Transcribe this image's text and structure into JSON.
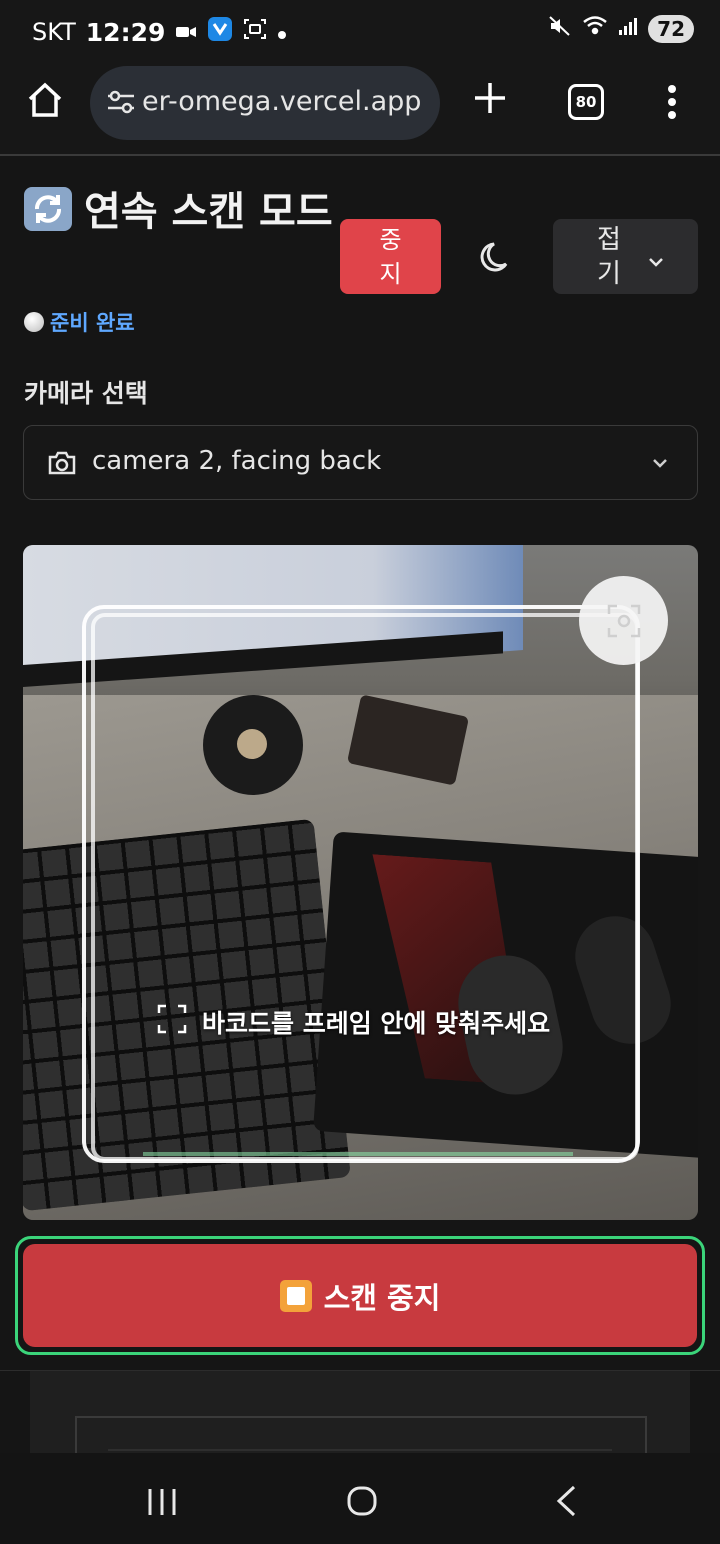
{
  "status_bar": {
    "carrier": "SKT",
    "time": "12:29",
    "battery": "72"
  },
  "browser": {
    "url": "er-omega.vercel.app",
    "tab_count": "80"
  },
  "header": {
    "title": "연속 스캔 모드",
    "stop_small_label": "중지",
    "collapse_label": "접기",
    "status_text": "준비 완료"
  },
  "camera": {
    "label": "카메라 선택",
    "selected": "camera 2, facing back",
    "hint": "바코드를 프레임 안에 맞춰주세요"
  },
  "actions": {
    "stop_scan_label": "스캔 중지"
  },
  "colors": {
    "stop_red": "#c83a3f",
    "accent_green": "#3bd47a",
    "status_blue": "#5fa8ff"
  },
  "icons": [
    "home-icon",
    "tune-icon",
    "plus-icon",
    "tabs-icon",
    "more-icon",
    "refresh-icon",
    "moon-icon",
    "chevron-down-icon",
    "camera-icon",
    "camera-flip-icon",
    "scan-corners-icon",
    "stop-icon",
    "recents-icon",
    "nav-home-icon",
    "back-icon"
  ]
}
